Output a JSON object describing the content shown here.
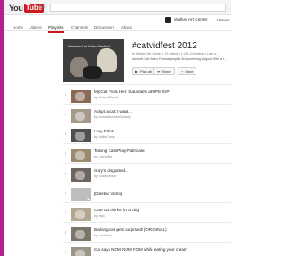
{
  "header": {
    "logo_you": "You",
    "logo_tube": "Tube",
    "region": "KE"
  },
  "channel": {
    "tabs": [
      "Home",
      "Videos",
      "Playlists",
      "Channels",
      "Discussion",
      "About"
    ],
    "name": "Walker Art Center",
    "videos_link": "Videos"
  },
  "playlist": {
    "thumb_label": "Internet Cat Video Festival",
    "title": "#catvidfest 2012",
    "meta": "by Walker Art Center • 70 videos • 1,161,244 views • Last u...",
    "description": "Internet Cat Video Festival playlist 3rd screening August 30th at t...",
    "play_all": "Play all",
    "share": "Share",
    "save": "Save"
  },
  "rows": [
    {
      "idx": "1",
      "title": "My Cat From Hell: Saturdays at 9PM E/P*",
      "by": "by Animal Planet"
    },
    {
      "idx": "2",
      "title": "Adopt a cat: I want...",
      "by": "by AnimalHumaneSociety"
    },
    {
      "idx": "3",
      "title": "Lucy Films",
      "by": "by LollieCamp"
    },
    {
      "idx": "4",
      "title": "Talking Cats Play Pattycake",
      "by": "by Juhi kitter"
    },
    {
      "idx": "5",
      "title": "Gary's disgusted...",
      "by": "by GoldsVentor"
    },
    {
      "idx": "6",
      "title": "[Deleted Video]",
      "by": ""
    },
    {
      "idx": "7",
      "title": "Cute cat thinks it's a dog",
      "by": "by rdyo"
    },
    {
      "idx": "8",
      "title": "Barking cat gets surprised! (ORIGINAL)",
      "by": "by noelcitafy"
    },
    {
      "idx": "9",
      "title": "Cat says NOM NOM NOM while eating your cream",
      "by": ""
    }
  ]
}
